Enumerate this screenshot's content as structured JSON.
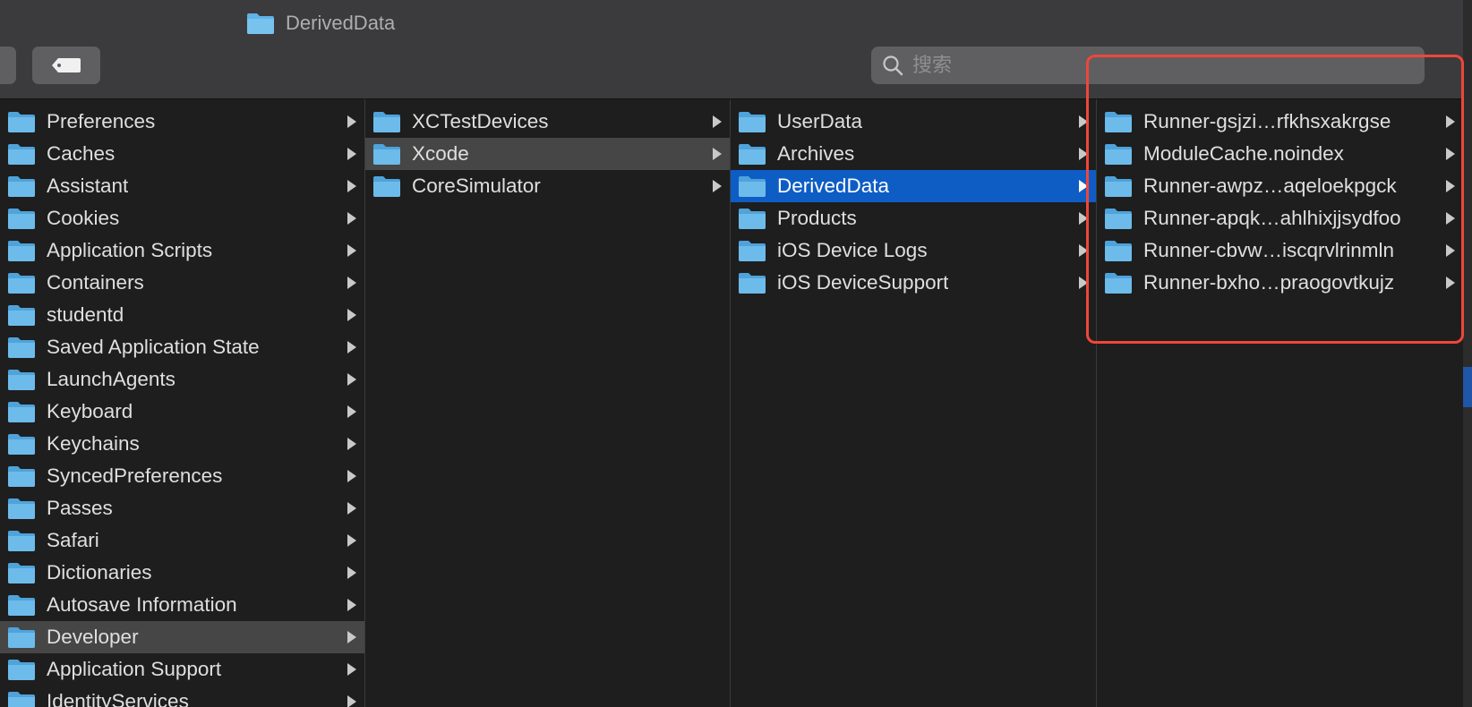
{
  "window": {
    "title": "DerivedData"
  },
  "toolbar": {
    "tag_icon": "tag-icon"
  },
  "search": {
    "placeholder": "搜索",
    "value": ""
  },
  "columns": [
    {
      "items": [
        {
          "label": "Preferences",
          "has_children": true
        },
        {
          "label": "Caches",
          "has_children": true
        },
        {
          "label": "Assistant",
          "has_children": true
        },
        {
          "label": "Cookies",
          "has_children": true
        },
        {
          "label": "Application Scripts",
          "has_children": true
        },
        {
          "label": "Containers",
          "has_children": true
        },
        {
          "label": "studentd",
          "has_children": true
        },
        {
          "label": "Saved Application State",
          "has_children": true
        },
        {
          "label": "LaunchAgents",
          "has_children": true
        },
        {
          "label": "Keyboard",
          "has_children": true
        },
        {
          "label": "Keychains",
          "has_children": true
        },
        {
          "label": "SyncedPreferences",
          "has_children": true
        },
        {
          "label": "Passes",
          "has_children": true
        },
        {
          "label": "Safari",
          "has_children": true
        },
        {
          "label": "Dictionaries",
          "has_children": true
        },
        {
          "label": "Autosave Information",
          "has_children": true
        },
        {
          "label": "Developer",
          "has_children": true,
          "selected": "grey"
        },
        {
          "label": "Application Support",
          "has_children": true
        },
        {
          "label": "IdentityServices",
          "has_children": true
        }
      ]
    },
    {
      "items": [
        {
          "label": "XCTestDevices",
          "has_children": true
        },
        {
          "label": "Xcode",
          "has_children": true,
          "selected": "grey"
        },
        {
          "label": "CoreSimulator",
          "has_children": true
        }
      ]
    },
    {
      "items": [
        {
          "label": "UserData",
          "has_children": true
        },
        {
          "label": "Archives",
          "has_children": true
        },
        {
          "label": "DerivedData",
          "has_children": true,
          "selected": "blue"
        },
        {
          "label": "Products",
          "has_children": true
        },
        {
          "label": "iOS Device Logs",
          "has_children": true
        },
        {
          "label": "iOS DeviceSupport",
          "has_children": true
        }
      ]
    },
    {
      "items": [
        {
          "label": "Runner-gsjzi…rfkhsxakrgse",
          "has_children": true
        },
        {
          "label": "ModuleCache.noindex",
          "has_children": true
        },
        {
          "label": "Runner-awpz…aqeloekpgck",
          "has_children": true
        },
        {
          "label": "Runner-apqk…ahlhixjjsydfoo",
          "has_children": true
        },
        {
          "label": "Runner-cbvw…iscqrvlrinmln",
          "has_children": true
        },
        {
          "label": "Runner-bxho…praogovtkujz",
          "has_children": true
        }
      ]
    }
  ],
  "colors": {
    "folder": "#5fb3e6",
    "selection_blue": "#0e5dc5",
    "selection_grey": "#464646",
    "highlight_box": "#f0463a"
  },
  "icons": {
    "folder": "folder-icon",
    "arrow": "chevron-right-icon",
    "search": "search-icon"
  }
}
